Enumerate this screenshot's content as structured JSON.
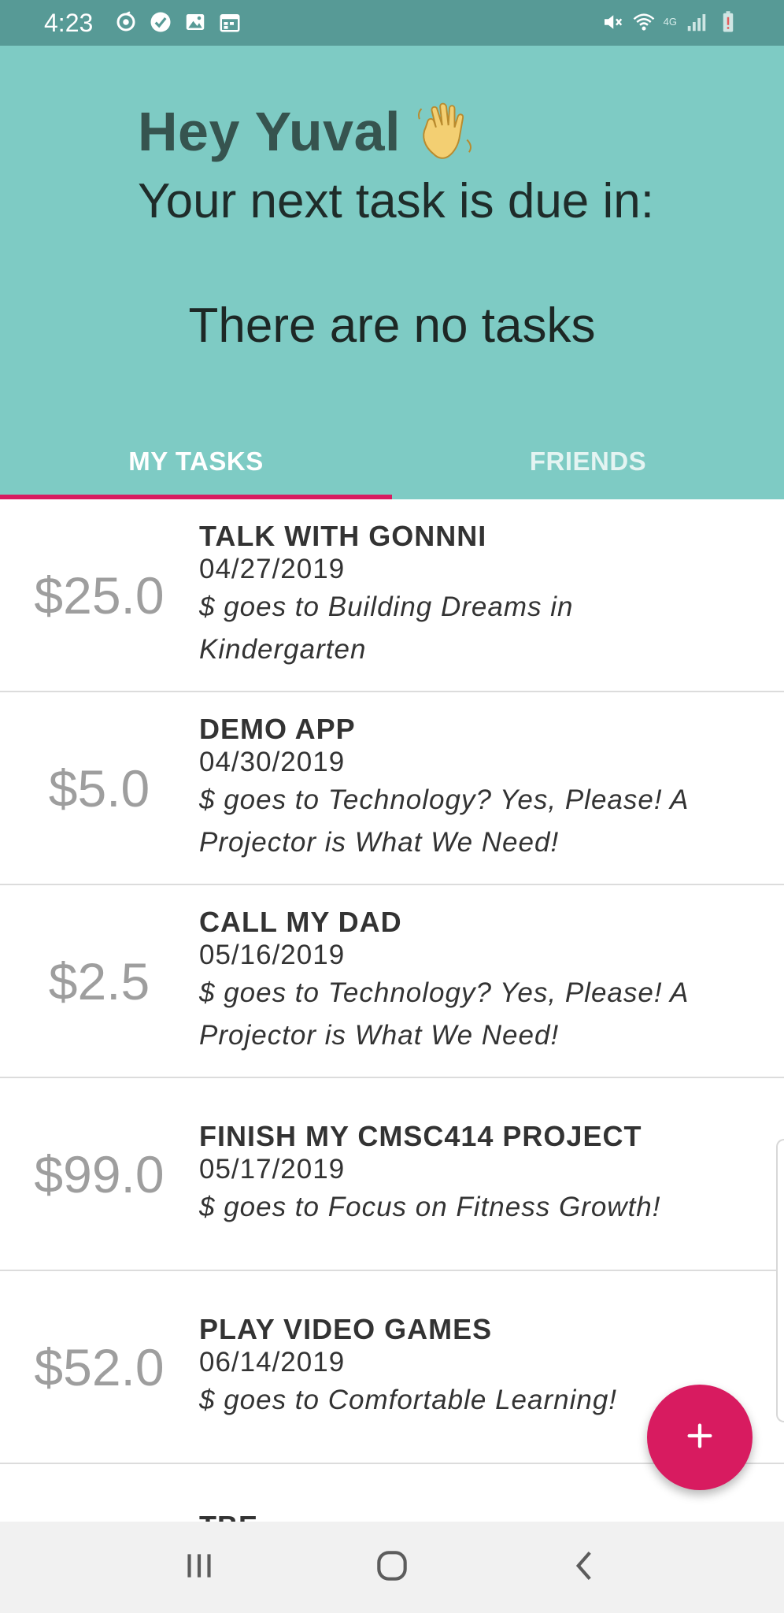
{
  "status_bar": {
    "time": "4:23",
    "network_label": "4G",
    "left_icons": [
      "sync-icon",
      "check-icon",
      "image-icon",
      "calendar-icon"
    ],
    "right_icons": [
      "mute-icon",
      "wifi-icon",
      "signal-icon",
      "battery-icon"
    ]
  },
  "header": {
    "greeting": "Hey Yuval",
    "greeting_icon": "waving-hand-icon",
    "subtitle": "Your next task is due in:",
    "no_tasks_text": "There are no tasks"
  },
  "tabs": [
    {
      "label": "MY TASKS",
      "active": true
    },
    {
      "label": "FRIENDS",
      "active": false
    }
  ],
  "tasks": [
    {
      "amount": "$25.0",
      "title": "TALK WITH GONNNI",
      "date": "04/27/2019",
      "charity": "$ goes to Building Dreams in Kindergarten"
    },
    {
      "amount": "$5.0",
      "title": "DEMO APP",
      "date": "04/30/2019",
      "charity": "$ goes to Technology? Yes, Please! A Projector is What We Need!"
    },
    {
      "amount": "$2.5",
      "title": "CALL MY DAD",
      "date": "05/16/2019",
      "charity": "$ goes to Technology? Yes, Please! A Projector is What We Need!"
    },
    {
      "amount": "$99.0",
      "title": "FINISH MY CMSC414 PROJECT",
      "date": "05/17/2019",
      "charity": "$ goes to Focus on Fitness Growth!"
    },
    {
      "amount": "$52.0",
      "title": "PLAY VIDEO GAMES",
      "date": "06/14/2019",
      "charity": "$ goes to Comfortable Learning!"
    }
  ],
  "partial_task": {
    "title": "TBE"
  },
  "fab": {
    "icon": "plus-icon"
  },
  "nav_bar": {
    "buttons": [
      "recent-apps-icon",
      "home-icon",
      "back-icon"
    ]
  },
  "colors": {
    "status_bar": "#579a96",
    "header": "#7ecbc4",
    "accent": "#d81b60",
    "amount_text": "#9e9e9e"
  }
}
